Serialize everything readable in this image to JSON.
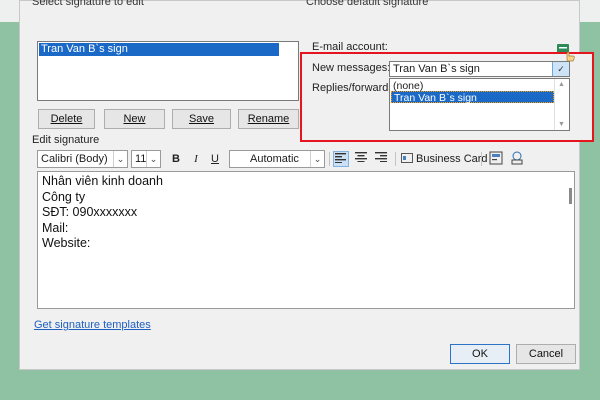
{
  "left": {
    "header": "Select signature to edit",
    "signatures": [
      "Tran Van B`s sign"
    ],
    "buttons": {
      "delete": "Delete",
      "new": "New",
      "save": "Save",
      "rename": "Rename"
    }
  },
  "right": {
    "header": "Choose default signature",
    "email_account_label": "E-mail account:",
    "new_messages_label": "New messages:",
    "new_messages_value": "Tran Van B`s sign",
    "replies_label": "Replies/forwards:",
    "replies_options": [
      "(none)",
      "Tran Van B`s sign"
    ]
  },
  "edit": {
    "label": "Edit signature",
    "font": "Calibri (Body)",
    "size": "11",
    "bold": "B",
    "italic": "I",
    "underline": "U",
    "color": "Automatic",
    "business_card": "Business Card",
    "lines": [
      "Nhân viên kinh doanh",
      "Công ty",
      "SĐT: 090xxxxxxx",
      "Mail:",
      "Website:"
    ]
  },
  "templates_link": "Get signature templates",
  "footer": {
    "ok": "OK",
    "cancel": "Cancel"
  },
  "colors": {
    "highlight": "#1b69c7",
    "red_box": "#e5151d",
    "background": "#8fc2a3"
  }
}
